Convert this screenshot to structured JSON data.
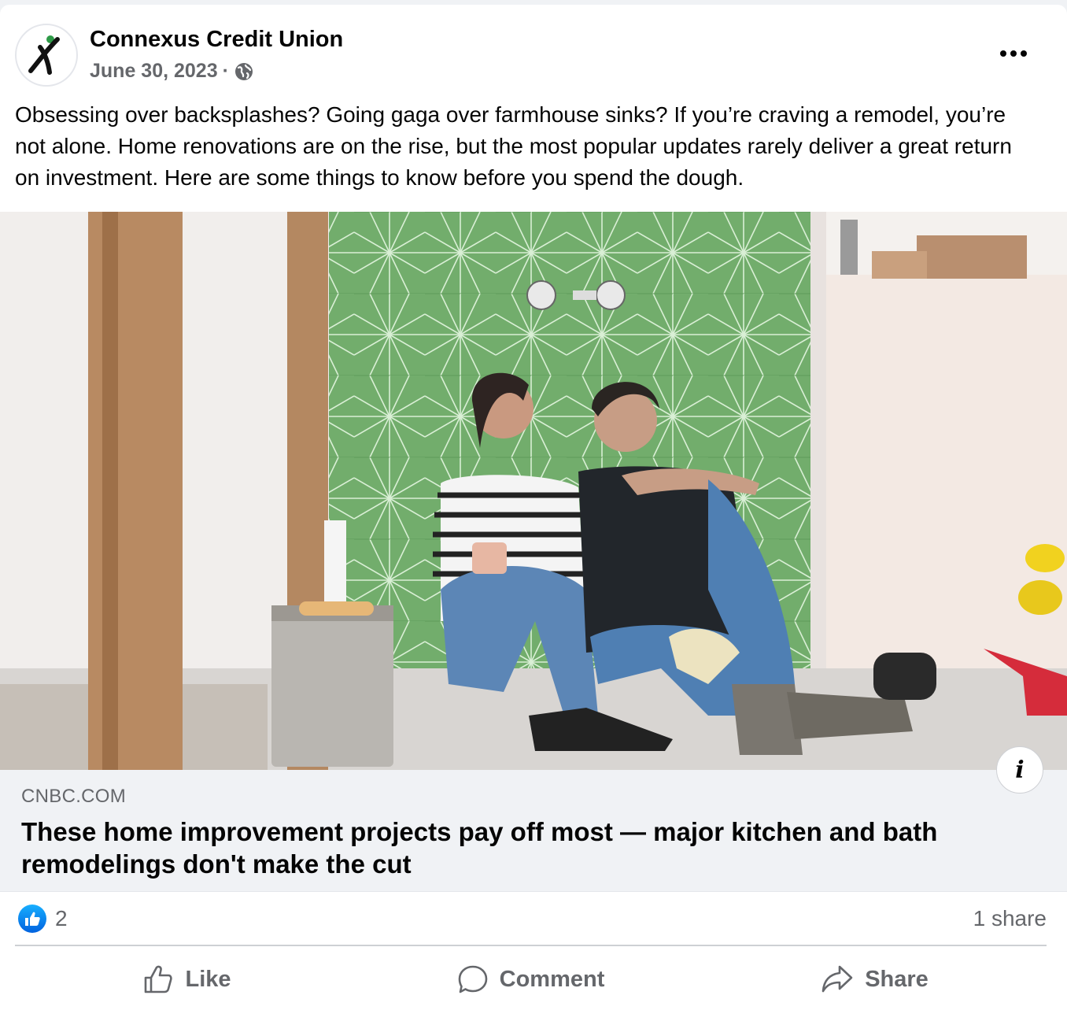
{
  "post": {
    "author": "Connexus Credit Union",
    "date": "June 30, 2023",
    "separator": "·",
    "privacy_icon": "globe-icon",
    "text": "Obsessing over backsplashes? Going gaga over farmhouse sinks? If you’re craving a remodel, you’re not alone. Home renovations are on the rise, but the most popular updates rarely deliver a great return on investment. Here are some things to know before you spend the dough."
  },
  "link": {
    "domain": "CNBC.COM",
    "headline": "These home improvement projects pay off most — major kitchen and bath remodelings don't make the cut",
    "info_icon": "i"
  },
  "stats": {
    "likes": "2",
    "shares": "1 share"
  },
  "actions": {
    "like": "Like",
    "comment": "Comment",
    "share": "Share"
  },
  "colors": {
    "brand_blue": "#0866ff",
    "muted_text": "#65676b",
    "tile_green": "#6fae6a"
  }
}
